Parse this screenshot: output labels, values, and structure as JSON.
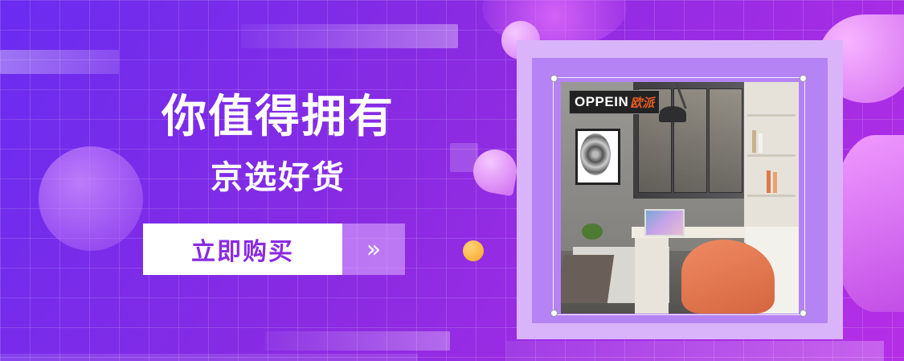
{
  "headline": "你值得拥有",
  "subheadline": "京选好货",
  "cta": {
    "label": "立即购买",
    "arrow_icon": "double-chevron-right-icon",
    "arrow_glyph": "»"
  },
  "product_image": {
    "brand_logo_text": "OPPEIN",
    "brand_logo_cn": "欧派"
  },
  "colors": {
    "background_start": "#6a2cf0",
    "background_end": "#b52ee6",
    "cta_text": "#8a2be2",
    "accent_orange": "#f5a623"
  }
}
